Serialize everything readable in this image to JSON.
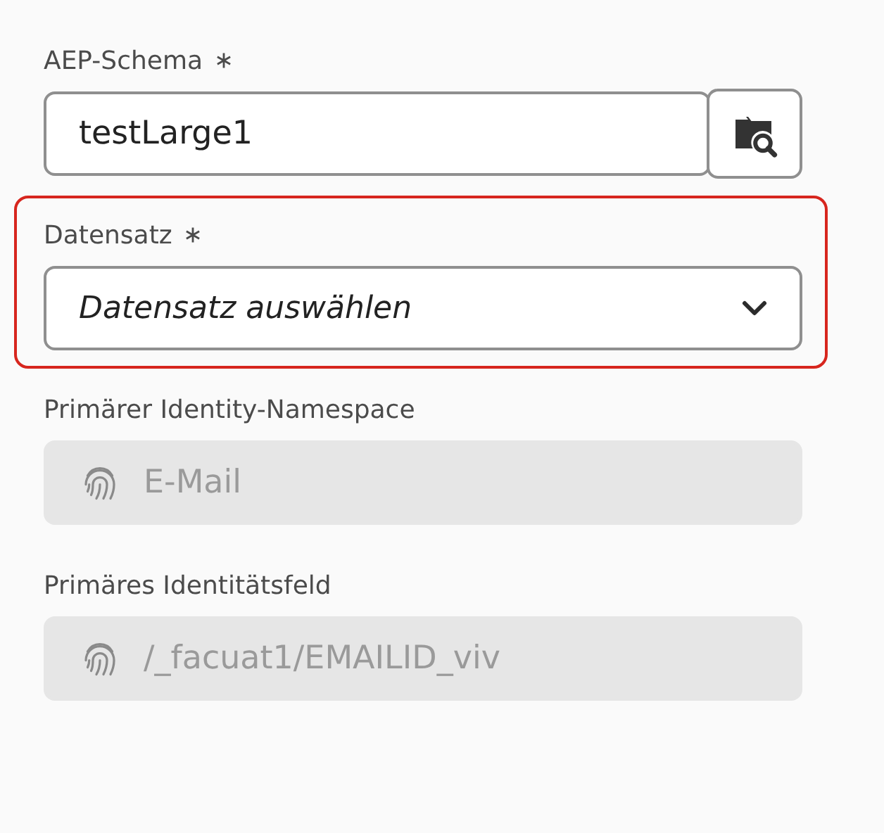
{
  "fields": [
    {
      "kind": "text",
      "label": "AEP-Schema",
      "required": true,
      "value": "testLarge1",
      "highlighted": false,
      "disabled": false
    },
    {
      "kind": "dropdown",
      "label": "Datensatz",
      "required": true,
      "placeholder": "Datensatz auswählen",
      "highlighted": true,
      "disabled": false
    },
    {
      "kind": "identity",
      "label": "Primärer Identity-Namespace",
      "required": false,
      "value": "E-Mail",
      "highlighted": false,
      "disabled": true
    },
    {
      "kind": "identity",
      "label": "Primäres Identitätsfeld",
      "required": false,
      "value": "/_facuat1/EMAILID_viv",
      "highlighted": false,
      "disabled": true
    }
  ]
}
